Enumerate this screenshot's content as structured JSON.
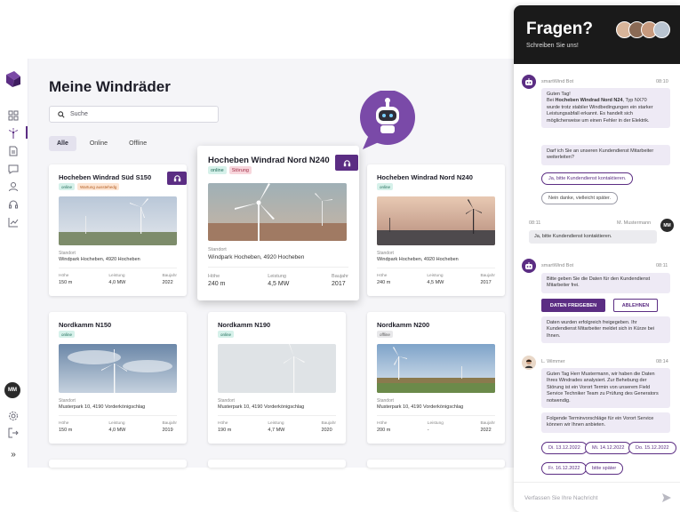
{
  "app": {
    "title": "Meine Windräder",
    "search_placeholder": "Suche",
    "tabs": [
      {
        "label": "Alle",
        "active": true
      },
      {
        "label": "Online",
        "active": false
      },
      {
        "label": "Offline",
        "active": false
      }
    ],
    "user_initials": "MM",
    "nav_icons": [
      "dashboard-icon",
      "turbine-icon",
      "document-icon",
      "message-icon",
      "user-icon",
      "headset-icon",
      "chart-icon"
    ],
    "bottom_icons": [
      "settings-icon",
      "logout-icon",
      "expand-icon"
    ],
    "collapse_glyph": "»"
  },
  "cards": [
    {
      "title": "Hocheben Windrad Süd S150",
      "badges": [
        {
          "text": "online",
          "type": "online"
        },
        {
          "text": "Wartung ausstehedg",
          "type": "warn"
        }
      ],
      "location_label": "Standort",
      "location": "Windpark Hocheben, 4920 Hocheben",
      "specs": [
        {
          "k": "Höhe",
          "v": "150 m"
        },
        {
          "k": "Leistung",
          "v": "4,0 MW"
        },
        {
          "k": "Baujahr",
          "v": "2022"
        }
      ],
      "support": true
    },
    {
      "title": "Hocheben Windrad Nord N240",
      "badges": [
        {
          "text": "online",
          "type": "online"
        },
        {
          "text": "Störung",
          "type": "err"
        }
      ],
      "location_label": "Standort",
      "location": "Windpark Hocheben, 4920 Hocheben",
      "specs": [
        {
          "k": "Höhe",
          "v": "240 m"
        },
        {
          "k": "Leistung",
          "v": "4,5 MW"
        },
        {
          "k": "Baujahr",
          "v": "2017"
        }
      ],
      "support": true
    },
    {
      "title": "Hocheben Windrad Nord N240",
      "badges": [
        {
          "text": "online",
          "type": "online"
        }
      ],
      "location_label": "Standort",
      "location": "Windpark Hocheben, 4920 Hocheben",
      "specs": [
        {
          "k": "Höhe",
          "v": "240 m"
        },
        {
          "k": "Leistung",
          "v": "4,5 MW"
        },
        {
          "k": "Baujahr",
          "v": "2017"
        }
      ],
      "support": false
    },
    {
      "title": "Nordkamm N150",
      "badges": [
        {
          "text": "online",
          "type": "online"
        }
      ],
      "location_label": "Standort",
      "location": "Musterpark 10, 4190 Vorderkönigschlag",
      "specs": [
        {
          "k": "Höhe",
          "v": "150 m"
        },
        {
          "k": "Leistung",
          "v": "4,0 MW"
        },
        {
          "k": "Baujahr",
          "v": "2019"
        }
      ],
      "support": false
    },
    {
      "title": "Nordkamm N190",
      "badges": [
        {
          "text": "online",
          "type": "online"
        }
      ],
      "location_label": "Standort",
      "location": "Musterpark 10, 4190 Vorderkönigschlag",
      "specs": [
        {
          "k": "Höhe",
          "v": "190 m"
        },
        {
          "k": "Leistung",
          "v": "4,7 MW"
        },
        {
          "k": "Baujahr",
          "v": "2020"
        }
      ],
      "support": false
    },
    {
      "title": "Nordkamm N200",
      "badges": [
        {
          "text": "offline",
          "type": "offline"
        }
      ],
      "location_label": "Standort",
      "location": "Musterpark 10, 4190 Vorderkönigschlag",
      "specs": [
        {
          "k": "Höhe",
          "v": "200 m"
        },
        {
          "k": "Leistung",
          "v": "-"
        },
        {
          "k": "Baujahr",
          "v": "2022"
        }
      ],
      "support": false
    }
  ],
  "chat": {
    "title": "Fragen?",
    "subtitle": "Schreiben Sie uns!",
    "bot_name": "smartWind Bot",
    "msg1_time": "08:10",
    "msg1_pre": "Guten Tag!",
    "msg1_line2_a": "Bei ",
    "msg1_line2_b": "Hocheben Windrad Nord N24",
    "msg1_line2_c": ", Typ NX70",
    "msg1_rest": "wurde trotz stabiler Windbedingungen ein starker Leistungsabfall erkannt. Es handelt sich möglicherweise um einen Fehler in der Elektrik.",
    "msg2": "Darf ich Sie an unseren Kundendienst Mitarbeiter weiterleiten?",
    "opt_yes": "Ja, bitte Kundendienst kontaktieren.",
    "opt_no": "Nein danke, vielleicht später.",
    "user_time": "08:11",
    "user_name": "M. Mustermann",
    "user_initials": "MM",
    "user_msg": "Ja, bitte Kundendienst kontaktieren.",
    "bot2_time": "08:11",
    "bot2_msg": "Bitte geben Sie die Daten für den Kundendienst Mitarbeiter frei.",
    "btn_release": "DATEN FREIGEBEN",
    "btn_decline": "ABLEHNEN",
    "bot2_confirm": "Daten wurden erfolgreich freigegeben. Ihr Kundendienst Mitarbeiter meldet sich in Kürze bei Ihnen.",
    "agent_name": "L. Wimmer",
    "agent_time": "08:14",
    "agent_msg": "Guten Tag Herr Mustermann, wir haben die Daten Ihres Windrades analysiert. Zur Behebung der Störung ist ein Vorort Termin von unserem Field Service Techniker Team zu Prüfung des Generators notwendig.",
    "agent_msg2": "Folgende Terminvorschläge für ein Vorort Service können wir Ihnen anbieten.",
    "dates": [
      "Di. 13.12.2022",
      "Mi. 14.12.2022",
      "Do. 15.12.2022",
      "Fr. 16.12.2022",
      "bitte später"
    ],
    "input_placeholder": "Verfassen Sie Ihre Nachricht",
    "accent": "#5b2d83"
  }
}
